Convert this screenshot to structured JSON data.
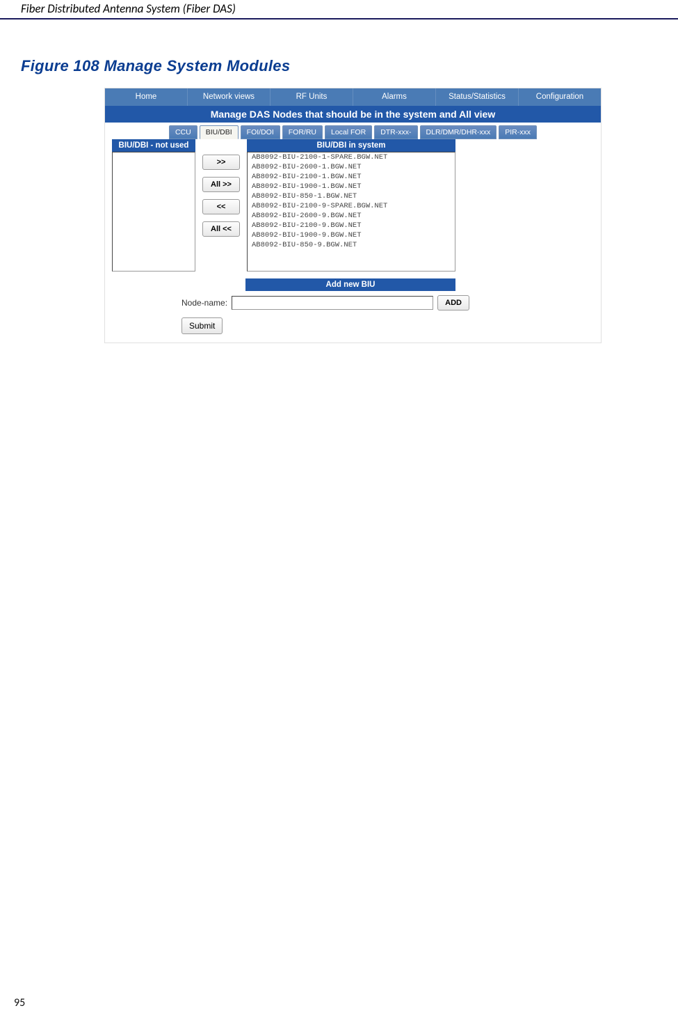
{
  "header": {
    "title": "Fiber Distributed Antenna System (Fiber DAS)"
  },
  "figure": {
    "label": "Figure 108    Manage System Modules"
  },
  "nav": {
    "items": [
      "Home",
      "Network views",
      "RF Units",
      "Alarms",
      "Status/Statistics",
      "Configuration"
    ]
  },
  "banner": "Manage DAS Nodes that should be in the system and All view",
  "tabs": {
    "items": [
      "CCU",
      "BIU/DBI",
      "FOI/DOI",
      "FOR/RU",
      "Local FOR",
      "DTR-xxx-",
      "DLR/DMR/DHR-xxx",
      "PIR-xxx"
    ],
    "activeIndex": 1
  },
  "lists": {
    "leftHeader": "BIU/DBI - not used",
    "rightHeader": "BIU/DBI in system",
    "leftItems": [],
    "rightItems": [
      "AB8092-BIU-2100-1-SPARE.BGW.NET",
      "AB8092-BIU-2600-1.BGW.NET",
      "AB8092-BIU-2100-1.BGW.NET",
      "AB8092-BIU-1900-1.BGW.NET",
      "AB8092-BIU-850-1.BGW.NET",
      "AB8092-BIU-2100-9-SPARE.BGW.NET",
      "AB8092-BIU-2600-9.BGW.NET",
      "AB8092-BIU-2100-9.BGW.NET",
      "AB8092-BIU-1900-9.BGW.NET",
      "AB8092-BIU-850-9.BGW.NET"
    ]
  },
  "moveButtons": {
    "addOne": ">>",
    "addAll": "All >>",
    "removeOne": "<<",
    "removeAll": "All <<"
  },
  "addNew": {
    "header": "Add new BIU",
    "label": "Node-name:",
    "value": "",
    "buttonLabel": "ADD"
  },
  "submit": {
    "label": "Submit"
  },
  "footer": {
    "pageNumber": "95"
  }
}
